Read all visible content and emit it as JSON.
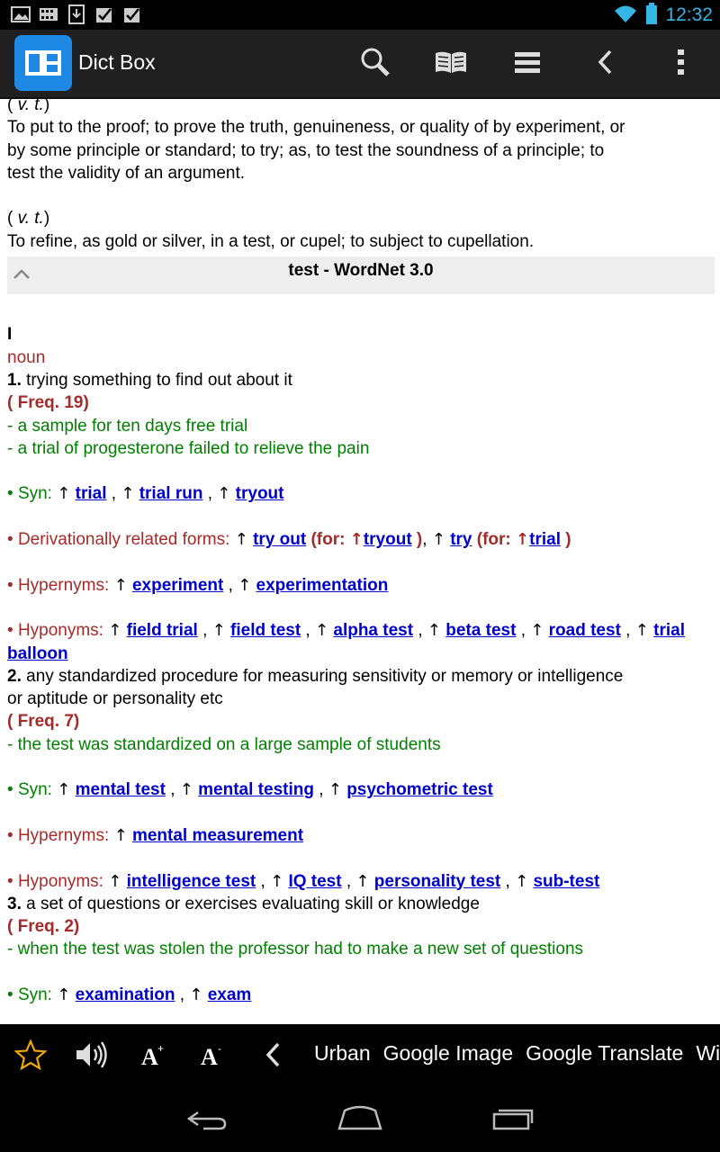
{
  "status": {
    "time": "12:32"
  },
  "app": {
    "title": "Dict Box"
  },
  "definitions": [
    {
      "pos": "v. t.",
      "lines": [
        "To put to the proof; to prove the truth, genuineness, or quality of by experiment, or",
        "by some principle or standard; to try; as, to test the soundness of a principle; to",
        "test the validity of an argument."
      ]
    },
    {
      "pos": "v. t.",
      "lines": [
        "To refine, as gold or silver, in a test, or cupel; to subject to cupellation."
      ]
    }
  ],
  "section": {
    "title": "test - WordNet 3.0"
  },
  "wordnet": {
    "roman": "I",
    "pos": "noun",
    "senses": [
      {
        "num": "1.",
        "gloss": "trying something to find out about it",
        "freq": "( Freq. 19)",
        "examples": [
          "- a sample for ten days free trial",
          "- a trial of progesterone failed to relieve the pain"
        ],
        "syn_label": "Syn:",
        "syn": [
          "trial",
          "trial run",
          "tryout"
        ],
        "deriv_label": "Derivationally related forms:",
        "deriv": [
          {
            "word": "try out",
            "for": "tryout"
          },
          {
            "word": "try",
            "for": "trial"
          }
        ],
        "hyper_label": "Hypernyms:",
        "hyper": [
          "experiment",
          "experimentation"
        ],
        "hypo_label": "Hyponyms:",
        "hypo": [
          "field trial",
          "field test",
          "alpha test",
          "beta test",
          "road test",
          "trial",
          "balloon"
        ]
      },
      {
        "num": "2.",
        "gloss": "any standardized procedure for measuring sensitivity or memory or intelligence",
        "gloss2": "or aptitude or personality etc",
        "freq": "( Freq. 7)",
        "examples": [
          "- the test was standardized on a large sample of students"
        ],
        "syn_label": "Syn:",
        "syn": [
          "mental test",
          "mental testing",
          "psychometric test"
        ],
        "hyper_label": "Hypernyms:",
        "hyper": [
          "mental measurement"
        ],
        "hypo_label": "Hyponyms:",
        "hypo": [
          "intelligence test",
          "IQ test",
          "personality test",
          "sub-test"
        ]
      },
      {
        "num": "3.",
        "gloss": "a set of questions or exercises evaluating skill or knowledge",
        "freq": "( Freq. 2)",
        "examples": [
          "- when the test was stolen the professor had to make a new set of questions"
        ],
        "syn_label": "Syn:",
        "syn": [
          "examination",
          "exam"
        ]
      }
    ]
  },
  "toolbar": {
    "links": [
      "Urban",
      "Google Image",
      "Google Translate",
      "Wi"
    ]
  },
  "colors": {
    "accent": "#33b5e5",
    "logo": "#1e88e5",
    "link": "#0000cc",
    "red": "#a52a2a",
    "green": "#008000"
  }
}
